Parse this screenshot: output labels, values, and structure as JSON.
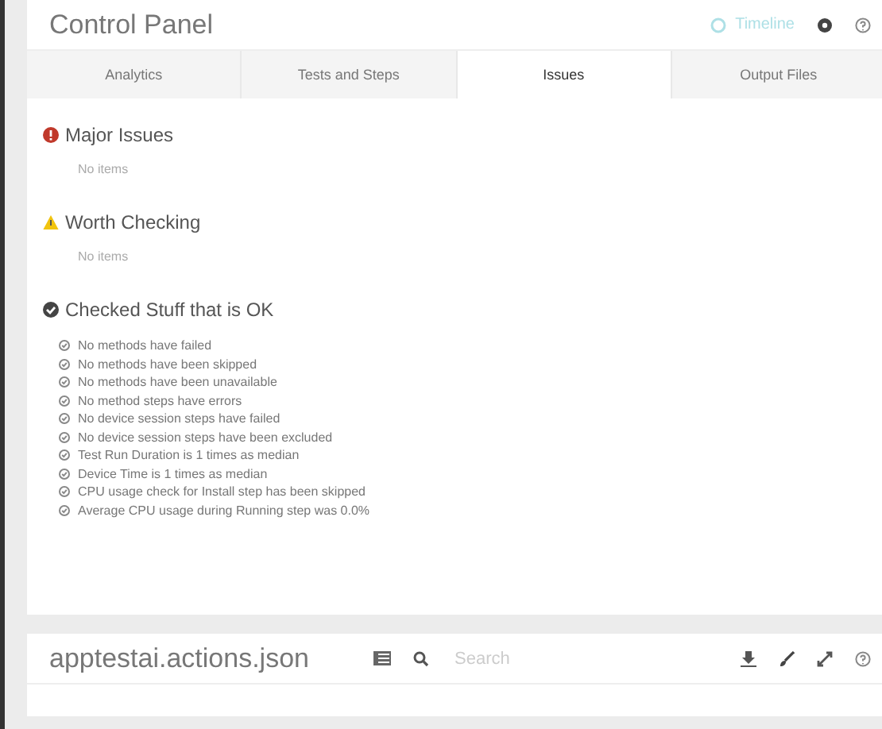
{
  "control_panel": {
    "title": "Control Panel",
    "timeline": "Timeline",
    "tabs": [
      {
        "label": "Analytics",
        "selected": false
      },
      {
        "label": "Tests and Steps",
        "selected": false
      },
      {
        "label": "Issues",
        "selected": true
      },
      {
        "label": "Output Files",
        "selected": false
      }
    ],
    "sections": [
      {
        "kind": "error",
        "title": "Major Issues",
        "empty": "No items"
      },
      {
        "kind": "warning",
        "title": "Worth Checking",
        "empty": "No items"
      },
      {
        "kind": "ok",
        "title": "Checked Stuff that is OK",
        "items": [
          "No methods have failed",
          "No methods have been skipped",
          "No methods have been unavailable",
          "No method steps have errors",
          "No device session steps have failed",
          "No device session steps have been excluded",
          "Test Run Duration is 1 times as median",
          "Device Time is 1 times as median",
          "CPU usage check for Install step has been skipped",
          "Average CPU usage during Running step was 0.0%"
        ]
      }
    ]
  },
  "file_panel": {
    "title": "apptestai.actions.json",
    "search": {
      "placeholder": "Search"
    }
  }
}
